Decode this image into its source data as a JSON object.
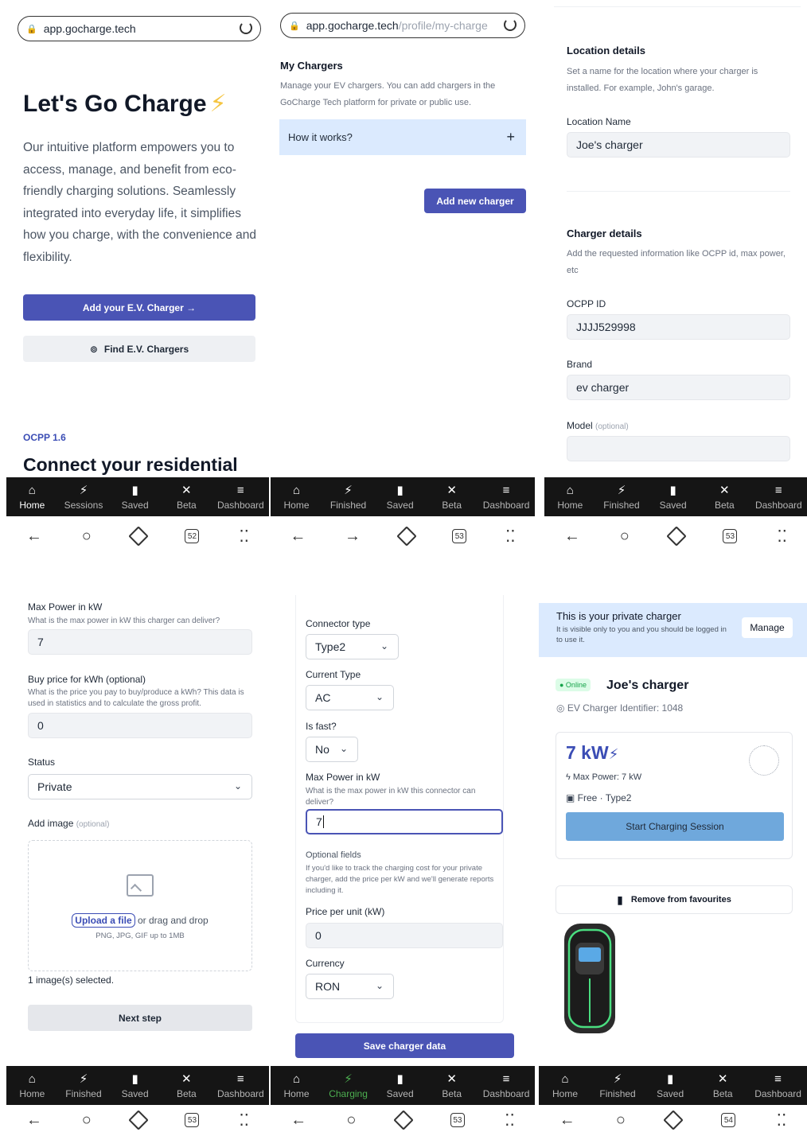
{
  "p1": {
    "url": "app.gocharge.tech",
    "title": "Let's Go Charge",
    "title_icon": "lightning-bolt-icon",
    "description": "Our intuitive platform empowers you to access, manage, and benefit from eco-friendly charging solutions. Seamlessly integrated into everyday life, it simplifies how you charge, with the convenience and flexibility.",
    "add_button": "Add your E.V. Charger →",
    "find_button": "Find E.V. Chargers",
    "ocpp": "OCPP 1.6",
    "connect_title": "Connect your residential",
    "nav": [
      "Home",
      "Sessions",
      "Saved",
      "Beta",
      "Dashboard"
    ],
    "tabs_count": "52"
  },
  "p2": {
    "url_host": "app.gocharge.tech",
    "url_path": "/profile/my-charge",
    "title": "My Chargers",
    "description": "Manage your EV chargers. You can add chargers in the GoCharge Tech platform for private or public use.",
    "accordion": "How it works?",
    "accordion_icon": "+",
    "add_button": "Add new charger",
    "nav": [
      "Home",
      "Finished",
      "Saved",
      "Beta",
      "Dashboard"
    ],
    "tabs_count": "53"
  },
  "p3": {
    "loc_title": "Location details",
    "loc_desc": "Set a name for the location where your charger is installed. For example, John's garage.",
    "loc_name_label": "Location Name",
    "loc_name_value": "Joe's charger",
    "charger_title": "Charger details",
    "charger_desc": "Add the requested information like OCPP id, max power, etc",
    "ocpp_label": "OCPP ID",
    "ocpp_value": "JJJJ529998",
    "brand_label": "Brand",
    "brand_value": "ev charger",
    "model_label": "Model",
    "model_optional": "(optional)",
    "model_value": "",
    "nav": [
      "Home",
      "Finished",
      "Saved",
      "Beta",
      "Dashboard"
    ],
    "tabs_count": "53"
  },
  "p4": {
    "max_power_label": "Max Power in kW",
    "max_power_hint": "What is the max power in kW this charger can deliver?",
    "max_power_value": "7",
    "buy_price_label": "Buy price for kWh (optional)",
    "buy_price_hint": "What is the price you pay to buy/produce a kWh? This data is used in statistics and to calculate the gross profit.",
    "buy_price_value": "0",
    "status_label": "Status",
    "status_value": "Private",
    "image_label": "Add image",
    "image_optional": "(optional)",
    "upload_link": "Upload a file",
    "upload_rest": "or drag and drop",
    "upload_hint": "PNG, JPG, GIF up to 1MB",
    "selected_text": "1 image(s) selected.",
    "next_button": "Next step",
    "nav": [
      "Home",
      "Finished",
      "Saved",
      "Beta",
      "Dashboard"
    ],
    "tabs_count": "53"
  },
  "p5": {
    "connector_label": "Connector type",
    "connector_value": "Type2",
    "current_label": "Current Type",
    "current_value": "AC",
    "fast_label": "Is fast?",
    "fast_value": "No",
    "max_power_label": "Max Power in kW",
    "max_power_hint": "What is the max power in kW this connector can deliver?",
    "max_power_value": "7",
    "optional_title": "Optional fields",
    "optional_hint": "If you'd like to track the charging cost for your private charger, add the price per kW and we'll generate reports including it.",
    "price_label": "Price per unit (kW)",
    "price_value": "0",
    "currency_label": "Currency",
    "currency_value": "RON",
    "save_button": "Save charger data",
    "nav": [
      "Home",
      "Charging",
      "Saved",
      "Beta",
      "Dashboard"
    ],
    "tabs_count": "53"
  },
  "p6": {
    "banner_title": "This is your private charger",
    "banner_desc": "It is visible only to you and you should be logged in to use it.",
    "manage_button": "Manage",
    "online_badge": "● Online",
    "charger_name": "Joe's charger",
    "identifier": "EV Charger Identifier: 1048",
    "power_value": "7 kW",
    "max_power": "Max Power: 7 kW",
    "pricing": "Free · Type2",
    "start_button": "Start Charging Session",
    "fav_button": "Remove from favourites",
    "nav": [
      "Home",
      "Finished",
      "Saved",
      "Beta",
      "Dashboard"
    ],
    "tabs_count": "54"
  },
  "colors": {
    "primary": "#4a54b5",
    "accent_blue": "#6fa8dc",
    "bolt_yellow": "#f5c542",
    "light_blue": "#dbeafe",
    "nav_bg": "#151515",
    "online_green": "#16a34a"
  }
}
